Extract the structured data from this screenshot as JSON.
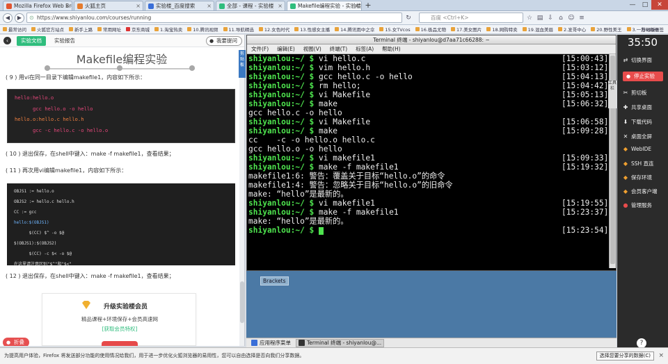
{
  "browser": {
    "tabs": [
      {
        "label": "Mozilla Firefox Web Browser",
        "color": "#e2552f",
        "active": false
      },
      {
        "label": "火狐主页",
        "color": "#e57b2d",
        "active": false
      },
      {
        "label": "实验楼_百度搜索",
        "color": "#3a6fd8",
        "active": false
      },
      {
        "label": "全部 - 课程 - 实验楼",
        "color": "#2fbd7d",
        "active": false
      },
      {
        "label": "Makefile编程实验 - 实验楼",
        "color": "#2fbd7d",
        "active": true
      }
    ],
    "new_tab": "+",
    "url": "https://www.shiyanlou.com/courses/running",
    "search_placeholder": "百度 <Ctrl+K>",
    "bookmarks": [
      "最常访问",
      "火狐官方站点",
      "新手上路",
      "常用网址",
      "京东商城",
      "1.淘宝热卖",
      "10.腾讯视频",
      "11.导航精选",
      "12.女色时代",
      "13.性感女主播",
      "14.腾讯雨中之伞",
      "15.女TVcos",
      "16.极品尤物",
      "17.美女图片",
      "18.网购特卖",
      "19.混血美眉",
      "2.发哥中心",
      "20.野性美王",
      "3.一万999级"
    ],
    "mobile_bookmarks": "移动版书签"
  },
  "doc": {
    "tab_doc": "实验文档",
    "tab_report": "实验报告",
    "ask_button": "我要提问",
    "title": "Makefile编程实验",
    "step9": "( 9 ) 用vi在同一目录下编辑makefile1，内容如下所示：",
    "step10": "( 10 ) 退出保存，在shell中键入：make -f makefile1，查看结果；",
    "step11": "( 11 ) 再次用vi编辑makefile1，内容如下所示：",
    "step12": "( 12 ) 退出保存，在shell中键入：make -f makefile1，查看结果；",
    "code1": [
      "hello:hello.o",
      "      gcc hello.o -o hello",
      "hello.o:hello.c hello.h",
      "      gcc -c hello.c -o hello.o"
    ],
    "code2": [
      "OBJS1 := hello.o",
      "OBJS2 := hello.c hello.h",
      "CC := gcc",
      "hello:$(OBJS1)",
      "      $(CC) $^ -o $@",
      "$(OBJS1):$(OBJS2)",
      "      $(CC) -c $< -o $@",
      "在这里请注意区别\"$^\"和\"$<\""
    ],
    "vip_title": "升级实验楼会员",
    "vip_sub": "精品课程+环境保存+会员高速网",
    "vip_link": "[获取会员特权]",
    "collapse": "折叠",
    "side_strip": "剪贴板"
  },
  "terminal": {
    "title": "Terminal 终端 - shiyanlou@d7aa71c66288: ~",
    "menu": [
      "文件(F)",
      "编辑(E)",
      "视图(V)",
      "终端(T)",
      "标签(A)",
      "帮助(H)"
    ],
    "prompt": "shiyanlou:~/ $",
    "lines": [
      {
        "cmd": "vi hello.c",
        "ts": "[15:00:43]"
      },
      {
        "cmd": "vim hello.h",
        "ts": "[15:03:12]"
      },
      {
        "cmd": "gcc hello.c -o hello",
        "ts": "[15:04:13]"
      },
      {
        "cmd": "rm hello;",
        "ts": "[15:04:42]"
      },
      {
        "cmd": "vi Makefile",
        "ts": "[15:05:13]"
      },
      {
        "cmd": "make",
        "ts": "[15:06:32]"
      },
      {
        "out": "gcc hello.c -o hello"
      },
      {
        "cmd": "vi Makefile",
        "ts": "[15:06:58]"
      },
      {
        "cmd": "make",
        "ts": "[15:09:28]"
      },
      {
        "out": "cc    -c -o hello.o hello.c"
      },
      {
        "out": "gcc hello.o -o hello"
      },
      {
        "cmd": "vi makefile1",
        "ts": "[15:09:33]"
      },
      {
        "cmd": "make -f makefile1",
        "ts": "[15:19:32]"
      },
      {
        "out": "makefile1:6: 警告：覆盖关于目标“hello.o”的命令"
      },
      {
        "out": "makefile1:4: 警告：忽略关于目标“hello.o”的旧命令"
      },
      {
        "out": "make: “hello”是最新的。"
      },
      {
        "cmd": "vi makefile1",
        "ts": "[15:19:55]"
      },
      {
        "cmd": "make -f makefile1",
        "ts": "[15:23:37]"
      },
      {
        "out": "make: “hello”是最新的。"
      },
      {
        "cmd": "",
        "ts": "[15:23:54]",
        "cursor": true
      }
    ]
  },
  "desktop": {
    "brackets_label": "Brackets",
    "taskbar_apps": "应用程序菜单",
    "taskbar_terminal": "Terminal 终端 - shiyanlou@..."
  },
  "sidebar": {
    "timer": "35:50",
    "items": [
      "切换界面",
      "停止实验",
      "剪切板",
      "共享桌面",
      "下载代码",
      "桌面全屏",
      "WebIDE",
      "SSH 直连",
      "保存环境",
      "会员客户端",
      "管理服务"
    ],
    "help": "帮助",
    "stop_color": "#e84c4c",
    "accent": "#2fbd7d"
  },
  "status": {
    "text": "为提高用户体验，Firefox 将发送部分功能的使用情况给我们，用于进一步优化火狐浏览器的易用性，您可以自由选择是否向我们分享数据。",
    "button": "选择您要分享的数据(C)",
    "close": "×"
  }
}
